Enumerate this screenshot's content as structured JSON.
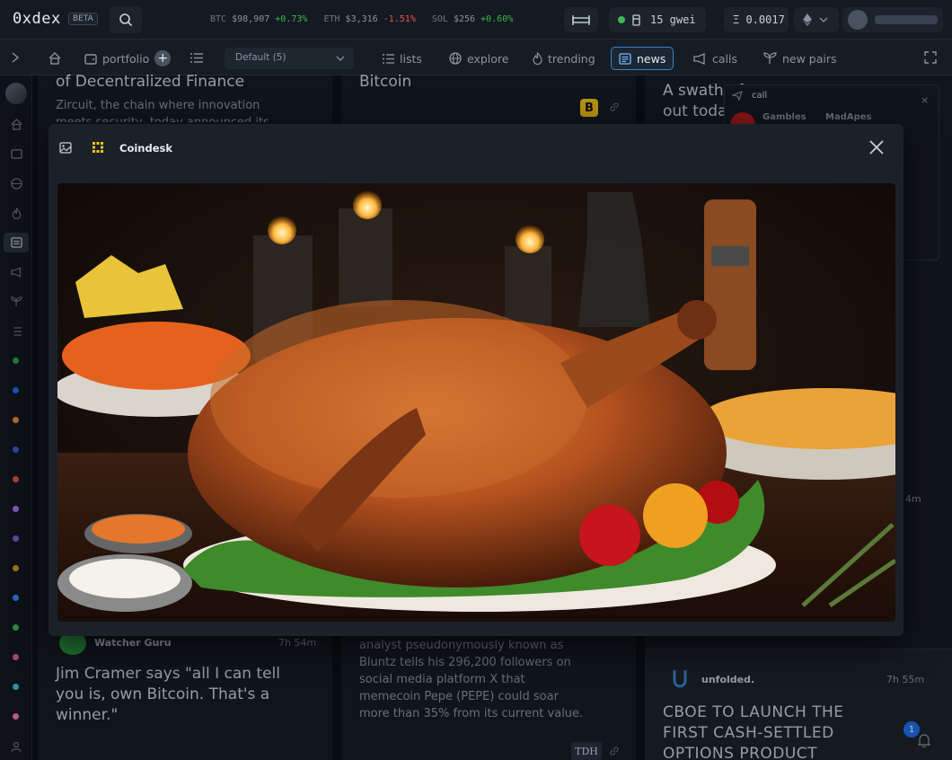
{
  "app": {
    "logo": "0xdex",
    "badge": "BETA"
  },
  "ticker": {
    "btc_sym": "BTC",
    "btc_price": "$98,907",
    "btc_chg": "+0.73%",
    "eth_sym": "ETH",
    "eth_price": "$3,316",
    "eth_chg": "-1.51%",
    "sol_sym": "SOL",
    "sol_price": "$256",
    "sol_chg": "+0.60%"
  },
  "topbar": {
    "gas": "15 gwei",
    "balance": "Ξ 0.0017"
  },
  "nav": {
    "portfolio": "portfolio",
    "preset": "Default (5)",
    "lists": "lists",
    "explore": "explore",
    "trending": "trending",
    "news": "news",
    "calls": "calls",
    "new_pairs": "new pairs"
  },
  "feed": {
    "col1_top_title": "of Decentralized Finance",
    "col1_top_body": "Zircuit, the chain where innovation meets security, today announced its",
    "col2_top_title": "Bitcoin",
    "col3_top_title": "A swath of",
    "col3_top_title2": "out toda",
    "call_label": "call",
    "call_source1": "Gambles",
    "call_source2": "MadApes",
    "col1_bottom_source": "Watcher Guru",
    "col1_bottom_time": "7h 54m",
    "col1_bottom_text": "Jim Cramer says \"all I can tell you is, own Bitcoin. That's a winner.\"",
    "col2_bottom_text": "analyst pseudonymously known as Bluntz tells his 296,200 followers on social media platform X that memecoin Pepe (PEPE) could soar more than 35% from its current value.",
    "col2_bottom_badge": "TDH",
    "col3_side_time": "4m",
    "col3_bottom_source": "unfolded.",
    "col3_bottom_time": "7h 55m",
    "col3_bottom_text": "CBOE TO LAUNCH THE FIRST CASH-SETTLED OPTIONS PRODUCT",
    "notif_count": "1"
  },
  "modal": {
    "source": "Coindesk"
  },
  "colors": {
    "accent": "#3b82c4",
    "positive": "#3fb950",
    "negative": "#f85149",
    "coindesk": "#f5c518"
  },
  "icons": [
    "search-icon",
    "home-icon",
    "wallet-icon",
    "globe-icon",
    "fire-icon",
    "news-icon",
    "megaphone-icon",
    "sprout-icon",
    "list-icon",
    "image-icon",
    "close-icon",
    "bell-icon",
    "user-icon",
    "expand-icon"
  ]
}
